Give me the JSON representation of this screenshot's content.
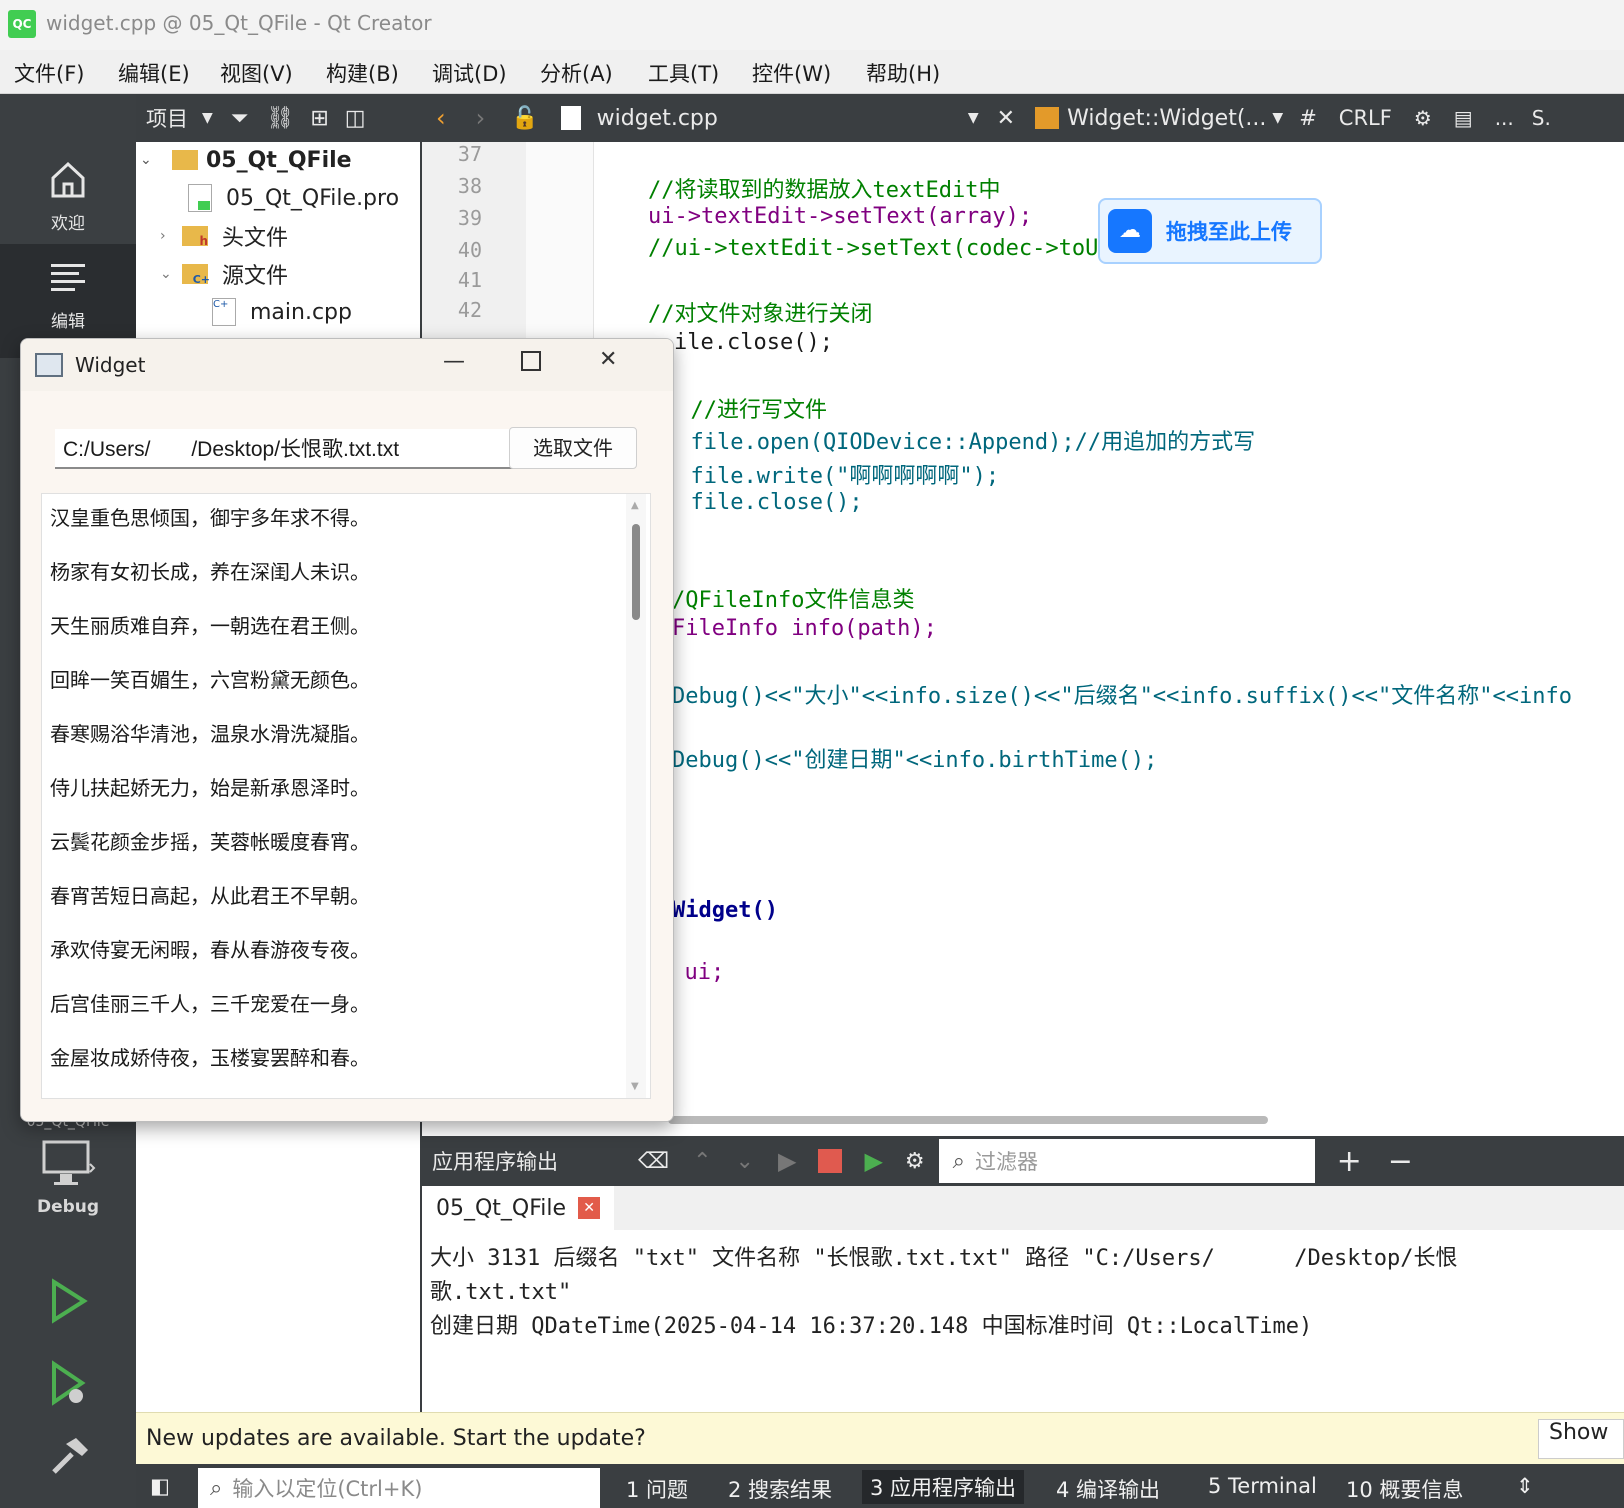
{
  "window": {
    "title": "widget.cpp @ 05_Qt_QFile - Qt Creator",
    "logo": "QC"
  },
  "menu": [
    "文件(F)",
    "编辑(E)",
    "视图(V)",
    "构建(B)",
    "调试(D)",
    "分析(A)",
    "工具(T)",
    "控件(W)",
    "帮助(H)"
  ],
  "modes": {
    "welcome": "欢迎",
    "edit": "编辑",
    "debug": "Debug",
    "project_hint": "05_Qt_QFile"
  },
  "project": {
    "selector": "项目",
    "tree": [
      {
        "label": "05_Qt_QFile",
        "bold": true
      },
      {
        "label": "05_Qt_QFile.pro"
      },
      {
        "label": "头文件"
      },
      {
        "label": "源文件"
      },
      {
        "label": "main.cpp"
      }
    ]
  },
  "editor": {
    "file_tab": "widget.cpp",
    "symbol": "Widget::Widget(...",
    "hash": "#",
    "line_ending": "CRLF",
    "more": "...",
    "s": "S.",
    "line_numbers": [
      "37",
      "38",
      "39",
      "40",
      "41",
      "42"
    ],
    "lines": [
      {
        "cls": "cm",
        "text": "//将读取到的数据放入textEdit中"
      },
      {
        "cls": "",
        "text": "ui->textEdit->setText(array);"
      },
      {
        "cls": "cm",
        "text": "//ui->textEdit->setText(codec->toUnicode(array));"
      },
      {
        "cls": "cm",
        "text": "//对文件对象进行关闭"
      },
      {
        "cls": "",
        "text": "ile.close();"
      },
      {
        "cls": "cm",
        "text": "  //进行写文件"
      },
      {
        "cls": "",
        "text": "  file.open(QIODevice::Append);//用追加的方式写"
      },
      {
        "cls": "",
        "text": "  file.write(\"啊啊啊啊啊\");"
      },
      {
        "cls": "",
        "text": "  file.close();"
      },
      {
        "cls": "cm",
        "text": "/QFileInfo文件信息类"
      },
      {
        "cls": "",
        "text": "FileInfo info(path);"
      },
      {
        "cls": "",
        "text": "Debug()<<\"大小\"<<info.size()<<\"后缀名\"<<info.suffix()<<\"文件名称\"<<info"
      },
      {
        "cls": "",
        "text": "Debug()<<\"创建日期\"<<info.birthTime();"
      },
      {
        "cls": "",
        "text": "Widget()"
      },
      {
        "cls": "",
        "text": "  ui;"
      }
    ]
  },
  "upload_badge": "拖拽至此上传",
  "output": {
    "pane_title": "应用程序输出",
    "filter_placeholder": "过滤器",
    "tab": "05_Qt_QFile",
    "lines": [
      "大小 3131 后缀名 \"txt\" 文件名称 \"长恨歌.txt.txt\" 路径 \"C:/Users/      /Desktop/长恨",
      "歌.txt.txt\"",
      "创建日期 QDateTime(2025-04-14 16:37:20.148 中国标准时间 Qt::LocalTime)"
    ]
  },
  "notification": {
    "text": "New updates are available. Start the update?",
    "button": "Show"
  },
  "statusbar": {
    "locator_placeholder": "输入以定位(Ctrl+K)",
    "items": [
      "1 问题",
      "2 搜索结果",
      "3 应用程序输出",
      "4 编译输出",
      "5 Terminal",
      "10 概要信息"
    ]
  },
  "widget_window": {
    "title": "Widget",
    "path": "C:/Users/       /Desktop/长恨歌.txt.txt",
    "button": "选取文件",
    "poem": [
      "汉皇重色思倾国，御宇多年求不得。",
      "杨家有女初长成，养在深闺人未识。",
      "天生丽质难自弃，一朝选在君王侧。",
      "回眸一笑百媚生，六宫粉黛无颜色。",
      "春寒赐浴华清池，温泉水滑洗凝脂。",
      "侍儿扶起娇无力，始是新承恩泽时。",
      "云鬓花颜金步摇，芙蓉帐暖度春宵。",
      "春宵苦短日高起，从此君王不早朝。",
      "承欢侍宴无闲暇，春从春游夜专夜。",
      "后宫佳丽三千人，三千宠爱在一身。",
      "金屋妆成娇侍夜，玉楼宴罢醉和春。"
    ]
  }
}
